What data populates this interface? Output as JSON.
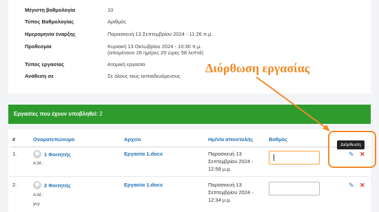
{
  "info": {
    "max_grade_label": "Μέγιστη βαθμολογία",
    "max_grade_value": "10",
    "grade_type_label": "Τύπος Βαθμολογίας",
    "grade_type_value": "Αριθμός",
    "start_date_label": "Ημερομηνία έναρξης",
    "start_date_value": "Παρασκευή 13 Σεπτεμβρίου 2024 - 11:26 π.μ.",
    "deadline_label": "Προθεσμία",
    "deadline_value": "Κυριακή 13 Οκτωβρίου 2024 - 10:30 π.μ.",
    "deadline_remaining": "(απομένουν 26 ημέρες 20 ώρες 58 λεπτά)",
    "assignment_type_label": "Τύπος εργασίας",
    "assignment_type_value": "Ατομική εργασία",
    "assigned_to_label": "Ανάθεση σε",
    "assigned_to_value": "Σε όλους τους εκπαιδευόμενους"
  },
  "annotation_text": "Διόρθωση εργασίας",
  "submissions": {
    "label": "Εργασίες που έχουν υποβληθεί:",
    "count": "2"
  },
  "table": {
    "headers": [
      "#",
      "Ονοματεπώνυμο",
      "Αρχείο",
      "Ημ/νία αποστολής",
      "Βαθμός"
    ],
    "rows": [
      {
        "num": "1.",
        "name": "1 Φοιτητής",
        "am": "Α.Μ.:",
        "extra": "",
        "file": "Εργασία 1.docx",
        "date1": "Παρασκευή 13",
        "date2": "Σεπτεμβρίου 2024 -",
        "date3": "12:58 μ.μ."
      },
      {
        "num": "2.",
        "name": "2 Φοιτητής",
        "am": "Α.Μ.:",
        "extra": "ycy",
        "file": "Εργασία 1.docx",
        "date1": "Παρασκευή 13",
        "date2": "Σεπτεμβρίου 2024 -",
        "date3": "12:34 μ.μ."
      }
    ]
  },
  "tooltip": "Διόρθωση",
  "icons": {
    "edit": "edit-icon",
    "delete": "close-icon"
  },
  "colors": {
    "accent": "#f08a24",
    "green": "#2e9b2e",
    "link": "#1f6fb5",
    "delete": "#d93025"
  }
}
